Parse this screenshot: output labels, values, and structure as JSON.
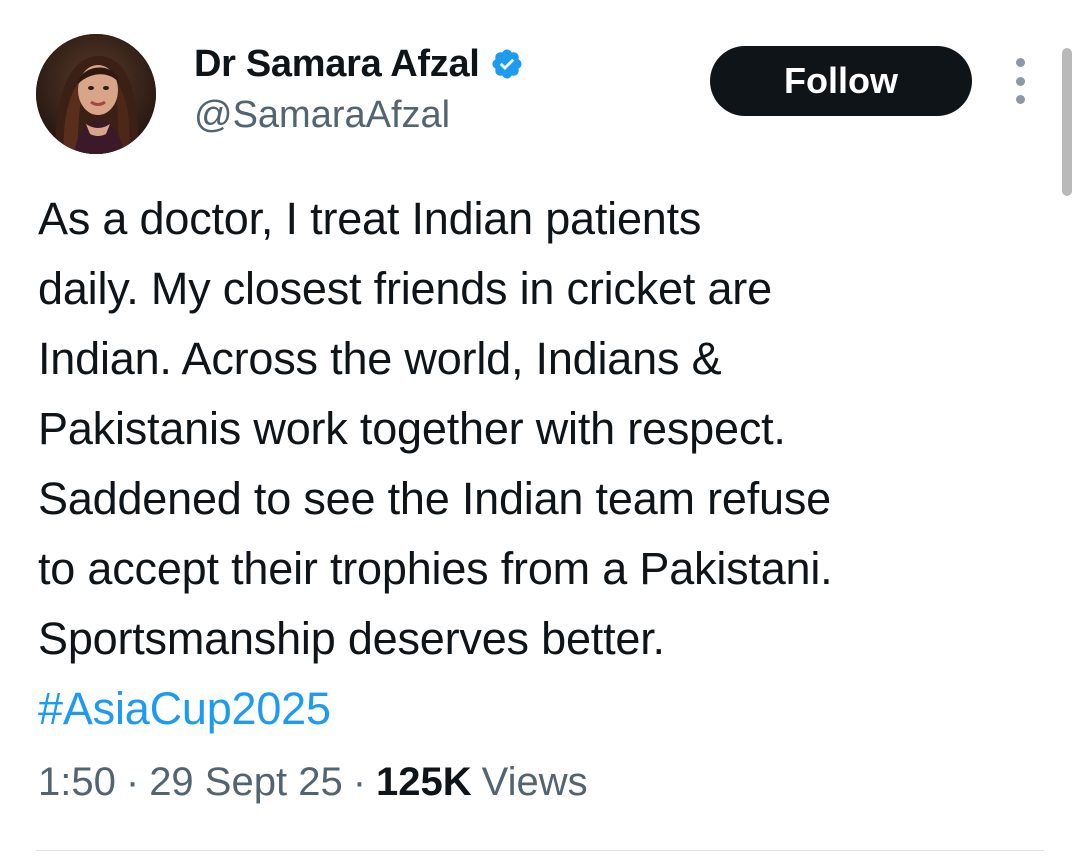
{
  "author": {
    "display_name": "Dr Samara Afzal",
    "handle": "@SamaraAfzal",
    "verified": true,
    "verified_color": "#1d9bf0"
  },
  "actions": {
    "follow_label": "Follow",
    "more_icon": "more-vertical-icon"
  },
  "tweet": {
    "lines": [
      "As a doctor, I treat Indian patients",
      "daily. My closest friends in cricket are",
      "Indian. Across the world, Indians &",
      "Pakistanis work together with respect.",
      "Saddened to see the Indian team refuse",
      "to accept their trophies from a Pakistani.",
      "Sportsmanship deserves better."
    ],
    "hashtag": "#AsiaCup2025",
    "hashtag_color": "#1d9bf0"
  },
  "meta": {
    "time": "1:50",
    "separator": "·",
    "date": "29 Sept 25",
    "views_count": "125K",
    "views_label": "Views"
  }
}
